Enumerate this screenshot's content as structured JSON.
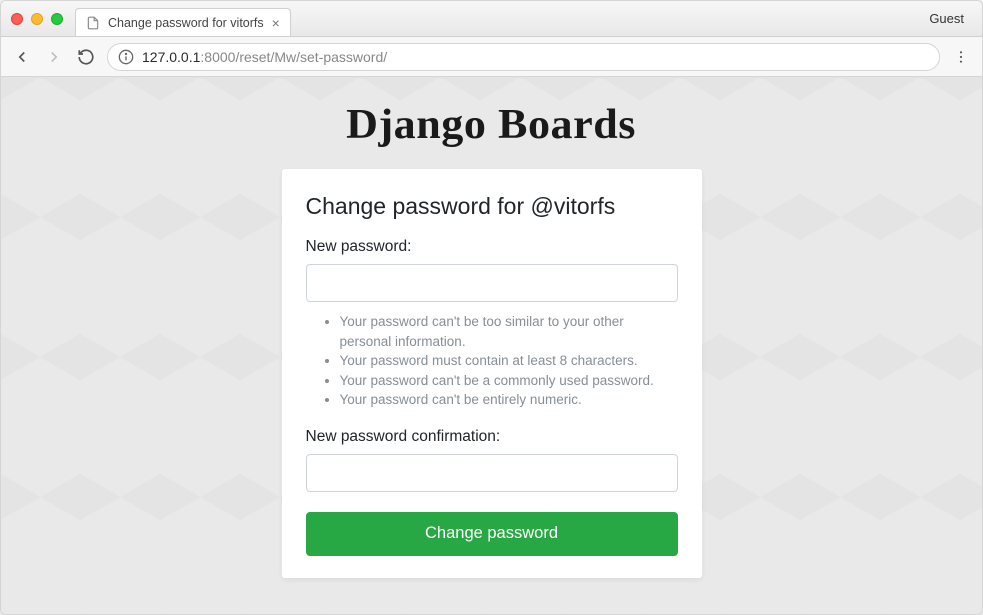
{
  "browser": {
    "tab_title": "Change password for vitorfs",
    "guest_label": "Guest",
    "url_host": "127.0.0.1",
    "url_port": ":8000",
    "url_path": "/reset/Mw/set-password/"
  },
  "page": {
    "site_title": "Django Boards",
    "card_title": "Change password for @vitorfs",
    "new_password_label": "New password:",
    "help_text": [
      "Your password can't be too similar to your other personal information.",
      "Your password must contain at least 8 characters.",
      "Your password can't be a commonly used password.",
      "Your password can't be entirely numeric."
    ],
    "new_password_confirm_label": "New password confirmation:",
    "submit_label": "Change password"
  }
}
